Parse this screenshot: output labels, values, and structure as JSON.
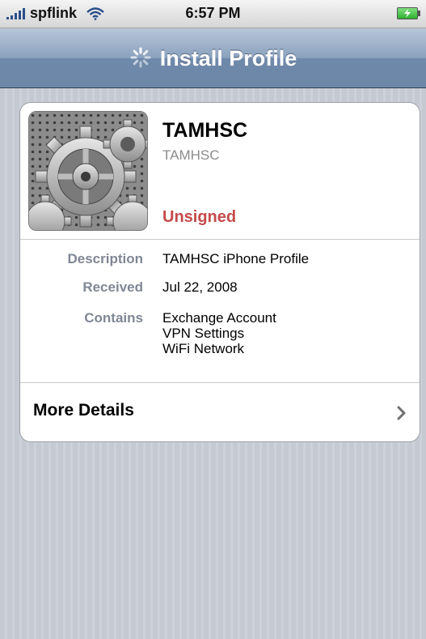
{
  "status_bar": {
    "carrier": "spflink",
    "time": "6:57 PM",
    "battery": "charging"
  },
  "nav": {
    "title": "Install Profile",
    "spinner_icon": "loading-spinner-icon"
  },
  "profile": {
    "icon": "settings-gears-icon",
    "name": "TAMHSC",
    "organization": "TAMHSC",
    "signature_status": "Unsigned",
    "signature_color": "#c54a4a"
  },
  "details": [
    {
      "label": "Description",
      "values": [
        "TAMHSC iPhone Profile"
      ]
    },
    {
      "label": "Received",
      "values": [
        "Jul 22, 2008"
      ]
    },
    {
      "label": "Contains",
      "values": [
        "Exchange Account",
        "VPN Settings",
        "WiFi Network"
      ]
    }
  ],
  "more_details": {
    "label": "More Details",
    "icon": "chevron-right-icon"
  },
  "colors": {
    "nav_bar": "#7f97b6",
    "background": "#c7cbd3",
    "label_gray": "#7f8794"
  }
}
